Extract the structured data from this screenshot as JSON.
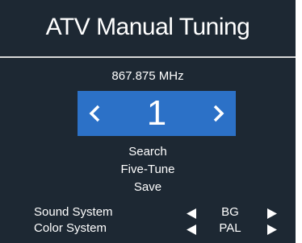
{
  "title": "ATV Manual Tuning",
  "frequency": "867.875 MHz",
  "channel": {
    "number": "1",
    "prev_icon": "chevron-left-icon",
    "next_icon": "chevron-right-icon"
  },
  "menu": [
    "Search",
    "Five-Tune",
    "Save"
  ],
  "settings": [
    {
      "label": "Sound System",
      "value": "BG"
    },
    {
      "label": "Color System",
      "value": "PAL"
    }
  ],
  "colors": {
    "panel_background": "#1d2833",
    "highlight": "#2c71c7",
    "text": "#ffffff",
    "divider": "#d8d8d8"
  }
}
